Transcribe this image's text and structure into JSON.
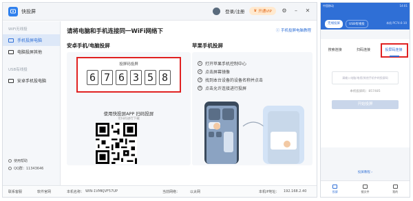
{
  "app": {
    "name": "快投屏"
  },
  "titlebar": {
    "login": "登录/注册",
    "vip": "开通VIP"
  },
  "sidebar": {
    "wifi_label": "WiFi无线投",
    "items": [
      {
        "label": "手机投屏电脑",
        "active": true
      },
      {
        "label": "电脑投屏其他",
        "active": false
      }
    ],
    "usb_label": "USB有线投",
    "usb_items": [
      {
        "label": "安卓手机投电脑"
      }
    ],
    "help": {
      "usage": "使用帮助",
      "qq": "QQ群：11343646"
    }
  },
  "main": {
    "heading": "请将电脑和手机连接同一WiFi网络下",
    "tutorial_link": "手机投屏电脑教程",
    "android_title": "安卓手机/电脑投屏",
    "code_label": "投屏码投屏",
    "code_digits": [
      "6",
      "7",
      "6",
      "3",
      "5",
      "8"
    ],
    "scan_text": "使用快投屏APP 扫码投屏",
    "scan_sub": "可扫码进行下载",
    "apple_title": "苹果手机投屏",
    "apple_steps": [
      "打开苹果手机控制中心",
      "点击屏幕镜像",
      "找到本台设备的设备名称并点击",
      "点击允许连接进行投屏"
    ]
  },
  "statusbar": {
    "contact": "联系客服",
    "website": "软件官网",
    "device_label": "本机名称：",
    "device_value": "WIN-1VMKJVF57UP",
    "network_label": "当前网络：",
    "network_value": "以太网",
    "ip_label": "本机IP地址：",
    "ip_value": "192.168.2.40"
  },
  "phone": {
    "status_left": "中国移动",
    "status_right": "14:01",
    "tabs": [
      {
        "label": "无线投屏",
        "on": true
      },
      {
        "label": "USB有线投",
        "on": false
      }
    ],
    "ip": "本机 PC74.6-10",
    "methods": [
      "搜索连接",
      "扫码连接",
      "投屏码连接"
    ],
    "input_placeholder": "请输入电脑/电视/其他手机中的投屏码",
    "local_code": "本机投屏码：857485",
    "start_button": "开始投屏",
    "tutorial": "投屏教程 ›",
    "nav": [
      {
        "label": "投屏",
        "on": true
      },
      {
        "label": "镜文件",
        "on": false
      },
      {
        "label": "我的",
        "on": false
      }
    ]
  },
  "colors": {
    "accent": "#2f6fd6",
    "highlight": "#e02020",
    "vip": "#e36a1a"
  }
}
